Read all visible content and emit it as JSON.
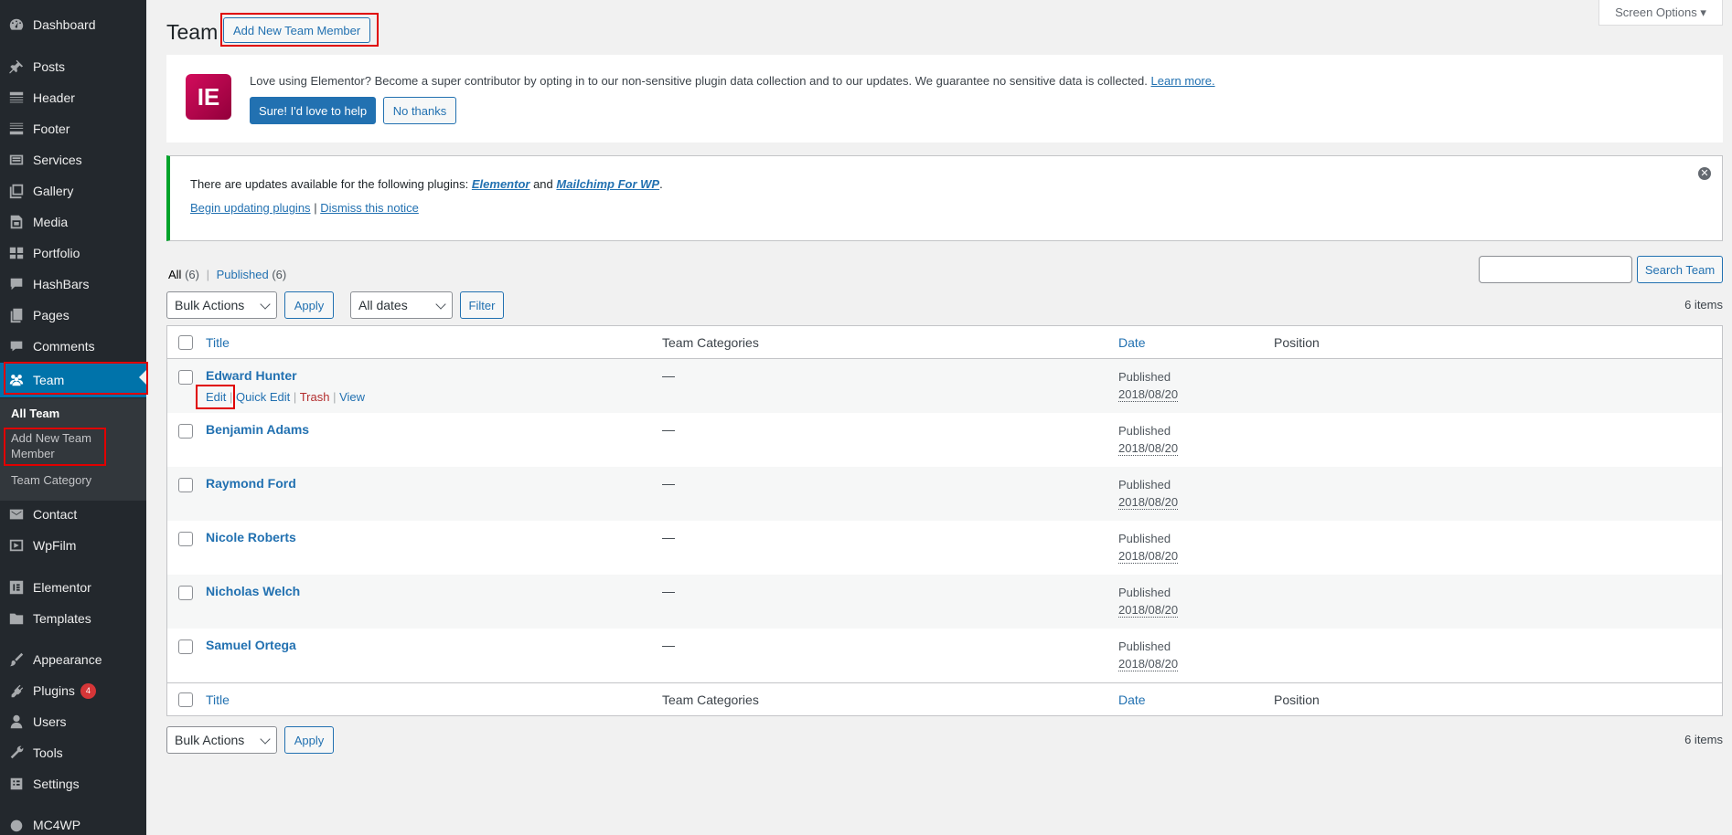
{
  "sidebar": {
    "items": [
      {
        "label": "Dashboard",
        "icon": "dashboard-icon"
      },
      {
        "label": "Posts",
        "icon": "pin-icon"
      },
      {
        "label": "Header",
        "icon": "header-icon"
      },
      {
        "label": "Footer",
        "icon": "footer-icon"
      },
      {
        "label": "Services",
        "icon": "services-icon"
      },
      {
        "label": "Gallery",
        "icon": "gallery-icon"
      },
      {
        "label": "Media",
        "icon": "media-icon"
      },
      {
        "label": "Portfolio",
        "icon": "portfolio-icon"
      },
      {
        "label": "HashBars",
        "icon": "speech-bubble-icon"
      },
      {
        "label": "Pages",
        "icon": "pages-icon"
      },
      {
        "label": "Comments",
        "icon": "comment-icon"
      },
      {
        "label": "Team",
        "icon": "team-icon"
      },
      {
        "label": "Contact",
        "icon": "email-icon"
      },
      {
        "label": "WpFilm",
        "icon": "video-icon"
      },
      {
        "label": "Elementor",
        "icon": "elementor-icon"
      },
      {
        "label": "Templates",
        "icon": "folder-icon"
      },
      {
        "label": "Appearance",
        "icon": "paintbrush-icon"
      },
      {
        "label": "Plugins",
        "icon": "plugin-icon",
        "badge": "4"
      },
      {
        "label": "Users",
        "icon": "user-icon"
      },
      {
        "label": "Tools",
        "icon": "wrench-icon"
      },
      {
        "label": "Settings",
        "icon": "settings-icon"
      },
      {
        "label": "MC4WP",
        "icon": "mc4wp-icon"
      }
    ],
    "submenu": {
      "all_team": "All Team",
      "add_new_line1": "Add New Team",
      "add_new_line2": "Member",
      "team_category": "Team Category"
    }
  },
  "header": {
    "title": "Team",
    "add_new_button": "Add New Team Member",
    "screen_options": "Screen Options ▾"
  },
  "elementor_notice": {
    "logo_text": "IE",
    "message": "Love using Elementor? Become a super contributor by opting in to our non-sensitive plugin data collection and to our updates. We guarantee no sensitive data is collected.",
    "learn_more": "Learn more.",
    "accept": "Sure! I'd love to help",
    "decline": "No thanks"
  },
  "update_notice": {
    "text_pre": "There are updates available for the following plugins:",
    "plugin1": "Elementor",
    "and": "and",
    "plugin2": "Mailchimp For WP",
    "period": ".",
    "begin_updating": "Begin updating plugins",
    "separator": "|",
    "dismiss": "Dismiss this notice"
  },
  "filters": {
    "all": "All",
    "all_count": "(6)",
    "sep": "|",
    "published": "Published",
    "published_count": "(6)",
    "bulk_actions": "Bulk Actions",
    "apply": "Apply",
    "all_dates": "All dates",
    "filter": "Filter",
    "search_button": "Search Team",
    "search_value": "",
    "items_count": "6 items"
  },
  "table": {
    "columns": {
      "title": "Title",
      "categories": "Team Categories",
      "date": "Date",
      "position": "Position"
    },
    "row_actions": {
      "edit": "Edit",
      "quick_edit": "Quick Edit",
      "trash": "Trash",
      "view": "View",
      "sep": "|"
    },
    "rows": [
      {
        "title": "Edward Hunter",
        "category": "—",
        "status": "Published",
        "date": "2018/08/20"
      },
      {
        "title": "Benjamin Adams",
        "category": "—",
        "status": "Published",
        "date": "2018/08/20"
      },
      {
        "title": "Raymond Ford",
        "category": "—",
        "status": "Published",
        "date": "2018/08/20"
      },
      {
        "title": "Nicole Roberts",
        "category": "—",
        "status": "Published",
        "date": "2018/08/20"
      },
      {
        "title": "Nicholas Welch",
        "category": "—",
        "status": "Published",
        "date": "2018/08/20"
      },
      {
        "title": "Samuel Ortega",
        "category": "—",
        "status": "Published",
        "date": "2018/08/20"
      }
    ]
  },
  "colors": {
    "sidebar_bg": "#23282d",
    "accent": "#2271b1",
    "active_menu": "#0073aa",
    "highlight": "#e00000"
  }
}
